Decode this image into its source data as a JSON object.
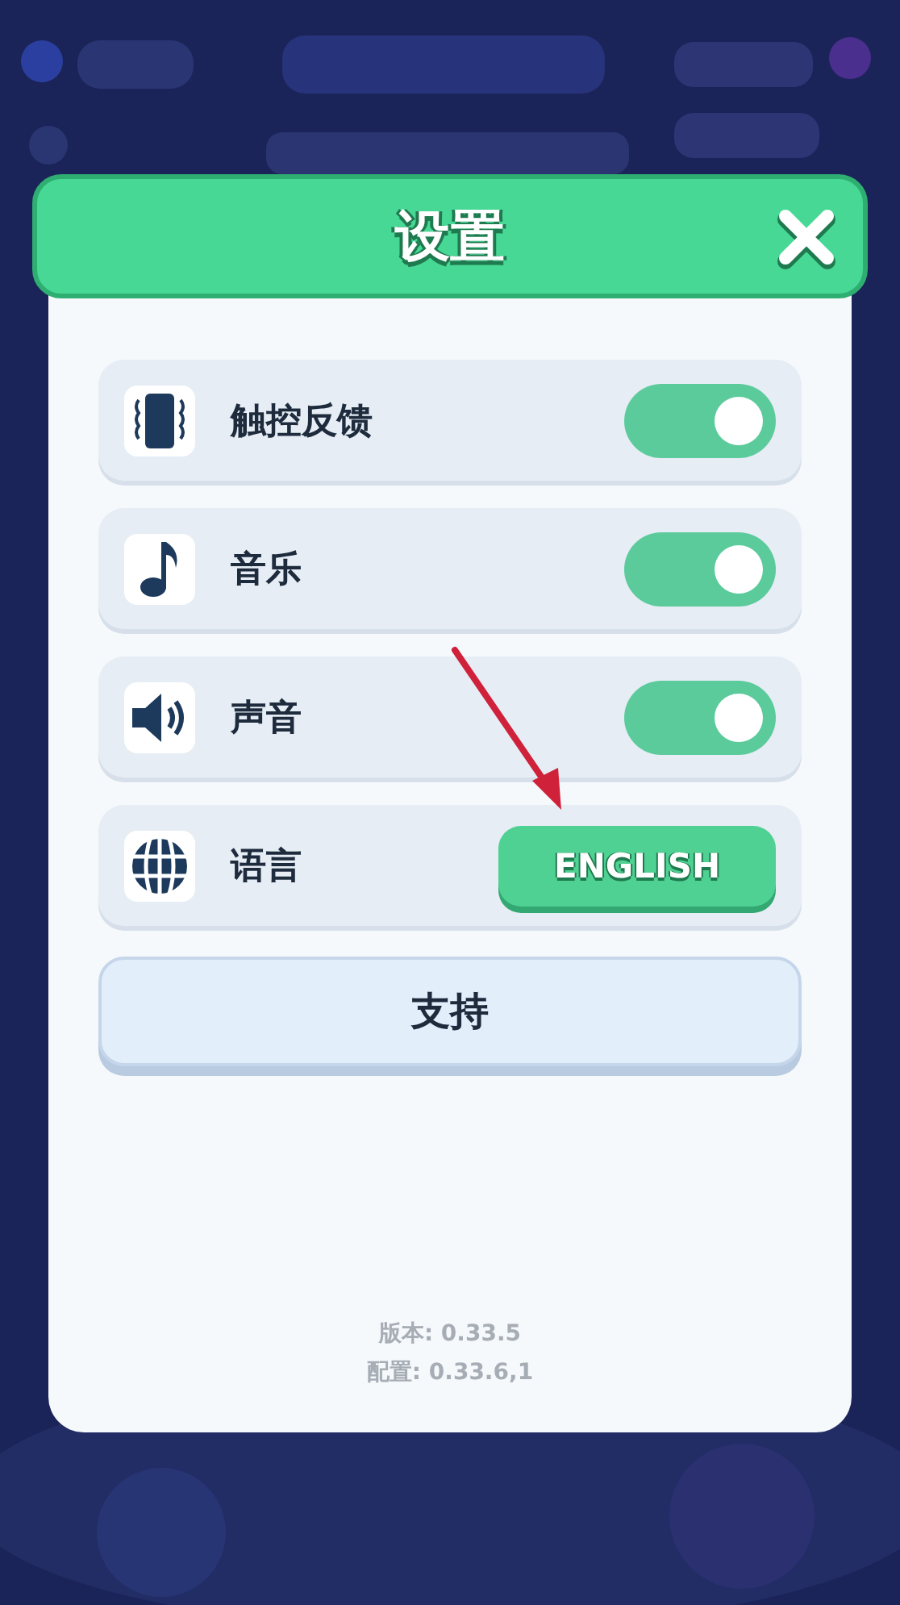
{
  "dialog": {
    "title": "设置"
  },
  "settings": [
    {
      "kind": "toggle",
      "label": "触控反馈",
      "on": true
    },
    {
      "kind": "toggle",
      "label": "音乐",
      "on": true
    },
    {
      "kind": "toggle",
      "label": "声音",
      "on": true
    },
    {
      "kind": "choice",
      "label": "语言",
      "value": "ENGLISH"
    }
  ],
  "support_button": "支持",
  "footer": [
    "版本: 0.33.5",
    "配置: 0.33.6,1"
  ]
}
